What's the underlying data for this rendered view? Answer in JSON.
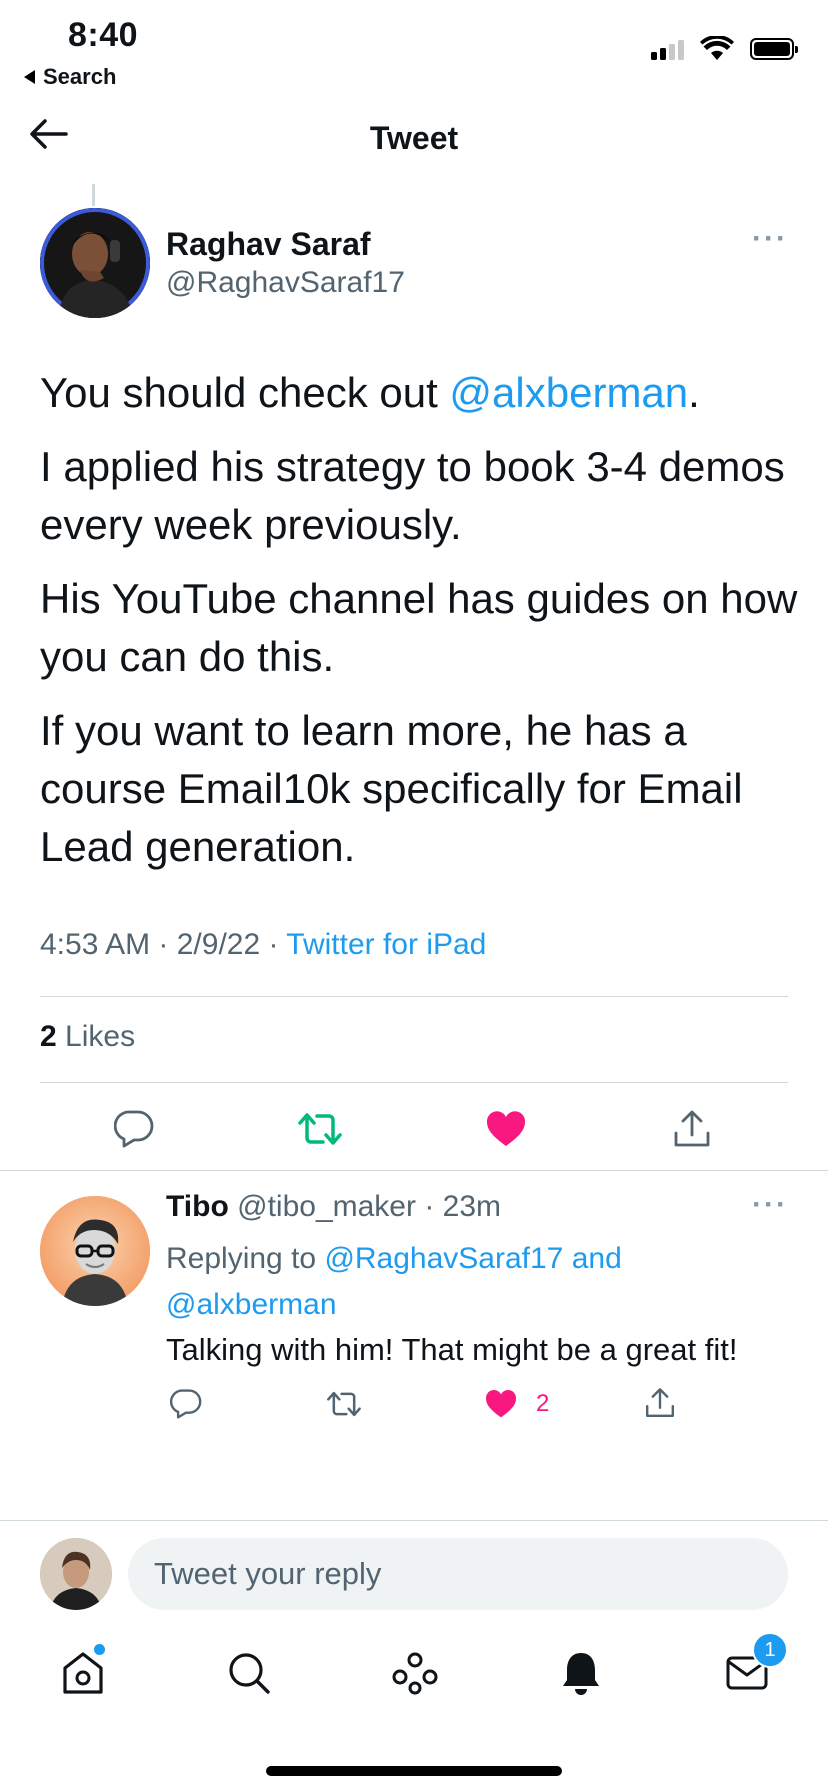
{
  "status_bar": {
    "time": "8:40",
    "back_app": "Search"
  },
  "header": {
    "title": "Tweet"
  },
  "tweet": {
    "author_name": "Raghav Saraf",
    "author_handle": "@RaghavSaraf17",
    "paragraphs": {
      "p1_prefix": "You should check out ",
      "p1_mention": "@alxberman",
      "p1_suffix": ".",
      "p2": "I applied his strategy to book 3-4 demos every week previously.",
      "p3": "His YouTube channel has guides on how you can do this.",
      "p4": "If you want to learn more, he has a course Email10k specifically for Email Lead generation."
    },
    "time": "4:53 AM",
    "date": "2/9/22",
    "source": "Twitter for iPad",
    "likes_count": "2",
    "likes_label": "Likes",
    "liked": true
  },
  "reply": {
    "name": "Tibo",
    "handle": "@tibo_maker",
    "age": "23m",
    "replying_prefix": "Replying to ",
    "replying_to": "@RaghavSaraf17 and @alxberman",
    "text": "Talking with him! That might be a great fit!",
    "like_count": "2"
  },
  "composer": {
    "placeholder": "Tweet your reply"
  },
  "tab_bar": {
    "items": [
      "home-icon",
      "search-icon",
      "spaces-icon",
      "notifications-icon",
      "messages-icon"
    ],
    "messages_badge": "1"
  },
  "colors": {
    "accent": "#1d9bf0",
    "retweet": "#00ba7c",
    "like": "#f91880",
    "muted": "#536471"
  }
}
